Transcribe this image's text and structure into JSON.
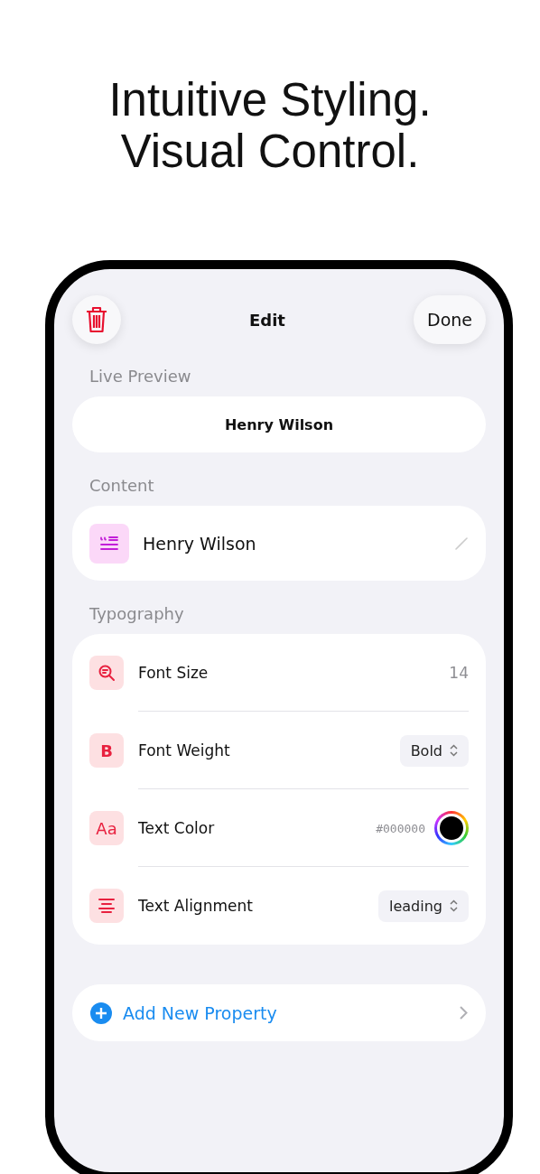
{
  "headline": [
    "Intuitive Styling.",
    "Visual Control."
  ],
  "nav": {
    "title": "Edit",
    "done": "Done"
  },
  "preview": {
    "label": "Live Preview",
    "text": "Henry Wilson"
  },
  "content": {
    "label": "Content",
    "value": "Henry Wilson"
  },
  "typography": {
    "label": "Typography",
    "rows": [
      {
        "kind": "value",
        "label": "Font Size",
        "value": "14"
      },
      {
        "kind": "picker",
        "label": "Font Weight",
        "value": "Bold",
        "glyph": "B"
      },
      {
        "kind": "color",
        "label": "Text Color",
        "value": "#000000",
        "glyph": "Aa"
      },
      {
        "kind": "picker",
        "label": "Text Alignment",
        "value": "leading"
      }
    ]
  },
  "add": {
    "label": "Add New Property"
  }
}
